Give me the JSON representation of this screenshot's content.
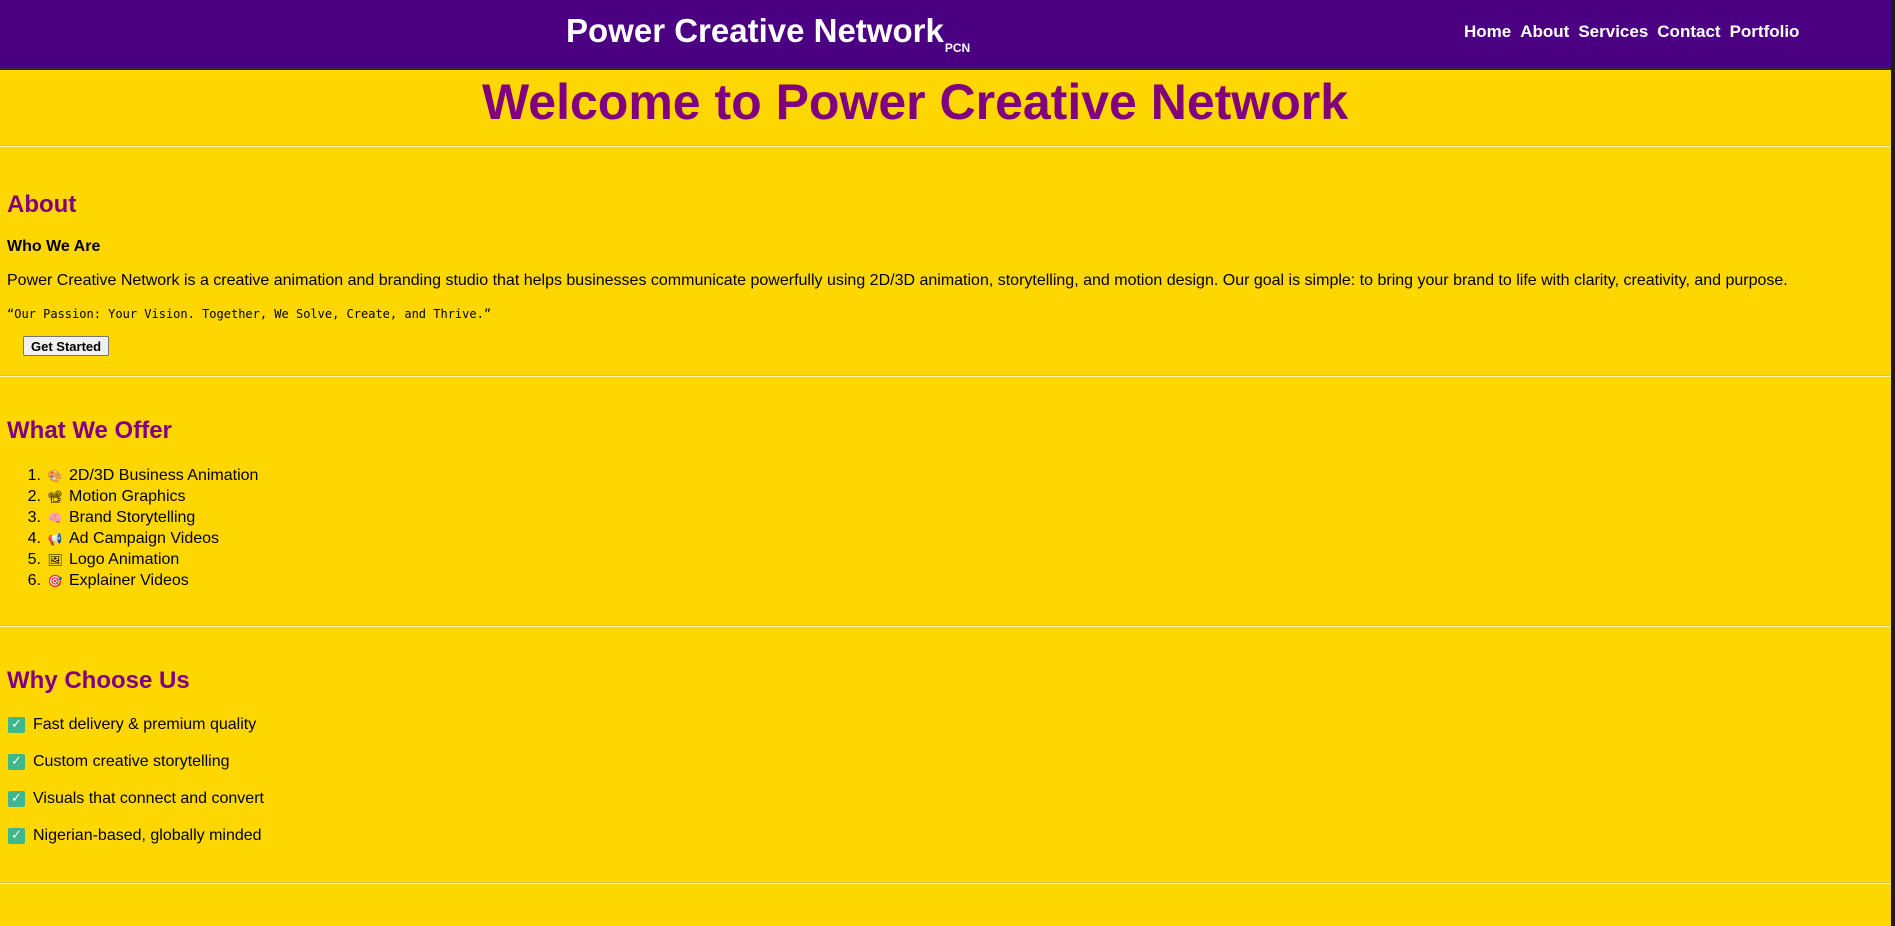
{
  "header": {
    "brand": "Power Creative Network",
    "brand_sub": "PCN",
    "nav": [
      {
        "label": "Home"
      },
      {
        "label": "About"
      },
      {
        "label": "Services"
      },
      {
        "label": "Contact"
      },
      {
        "label": "Portfolio"
      }
    ]
  },
  "hero": {
    "title": "Welcome to Power Creative Network"
  },
  "about": {
    "title": "About",
    "subtitle": "Who We Are",
    "text": "Power Creative Network is a creative animation and branding studio that helps businesses communicate powerfully using 2D/3D animation, storytelling, and motion design. Our goal is simple: to bring your brand to life with clarity, creativity, and purpose.",
    "quote": "“Our Passion: Your Vision. Together, We Solve, Create, and Thrive.”",
    "cta": "Get Started"
  },
  "offer": {
    "title": "What We Offer",
    "items": [
      {
        "num": "1.",
        "emoji": "🎨",
        "label": "2D/3D Business Animation"
      },
      {
        "num": "2.",
        "emoji": "📽",
        "label": "Motion Graphics"
      },
      {
        "num": "3.",
        "emoji": "🧠",
        "label": "Brand Storytelling"
      },
      {
        "num": "4.",
        "emoji": "📢",
        "label": "Ad Campaign Videos"
      },
      {
        "num": "5.",
        "emoji": "🖼",
        "label": "Logo Animation"
      },
      {
        "num": "6.",
        "emoji": "🎯",
        "label": "Explainer Videos"
      }
    ]
  },
  "why": {
    "title": "Why Choose Us",
    "check_icon": "✓",
    "items": [
      {
        "label": "Fast delivery & premium quality"
      },
      {
        "label": "Custom creative storytelling"
      },
      {
        "label": "Visuals that connect and convert"
      },
      {
        "label": "Nigerian-based, globally minded"
      }
    ]
  },
  "colors": {
    "header_bg": "#4b0082",
    "page_bg": "#ffd700",
    "heading": "#800080",
    "check_bg": "#3fb68b"
  }
}
